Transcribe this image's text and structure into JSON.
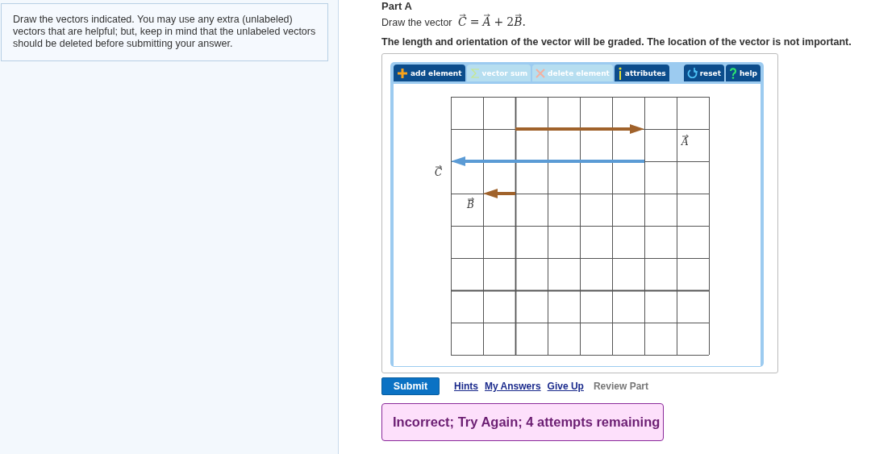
{
  "instructions": "Draw the vectors indicated. You may use any extra (unlabeled) vectors that are helpful; but, keep in mind that the unlabeled vectors should be deleted before submitting your answer.",
  "part_title": "Part A",
  "prompt": {
    "text": "Draw the vector",
    "equation": [
      {
        "symbol": "C",
        "vector": true
      },
      {
        "symbol": "=",
        "vector": false
      },
      {
        "symbol": "A",
        "vector": true
      },
      {
        "symbol": "+",
        "vector": false
      },
      {
        "symbol": "2",
        "vector": false
      },
      {
        "symbol": "B",
        "vector": true
      },
      {
        "symbol": ".",
        "vector": false
      }
    ]
  },
  "note": "The length and orientation of the vector will be graded. The location of the vector is not important.",
  "toolbar": [
    {
      "kind": "add",
      "label": "add element",
      "disabled": false
    },
    {
      "kind": "sum",
      "label": "vector sum",
      "disabled": true
    },
    {
      "kind": "delete",
      "label": "delete element",
      "disabled": true
    },
    {
      "kind": "info",
      "label": "attributes",
      "disabled": false
    },
    {
      "kind": "reset",
      "label": "reset",
      "disabled": false
    },
    {
      "kind": "help",
      "label": "help",
      "disabled": false
    }
  ],
  "vectors": [
    {
      "label": "A",
      "color": "#a0622b"
    },
    {
      "label": "C",
      "color": "#5b9bd5"
    },
    {
      "label": "B",
      "color": "#a0622b"
    }
  ],
  "submit": "Submit",
  "links": [
    "Hints",
    "My Answers",
    "Give Up"
  ],
  "review": "Review Part",
  "feedback": "Incorrect; Try Again; 4 attempts remaining"
}
